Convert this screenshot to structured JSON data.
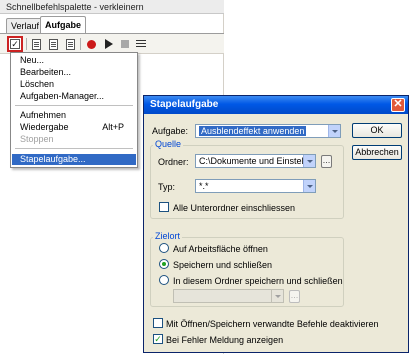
{
  "palette": {
    "title": "Schnellbefehlspalette - verkleinern",
    "tabs": [
      {
        "label": "Verlauf",
        "active": false
      },
      {
        "label": "Aufgabe",
        "active": true
      }
    ],
    "toolbar_icons": [
      "checkbox-icon",
      "new-document-icon",
      "new-document-icon",
      "new-document-icon",
      "record-icon",
      "play-icon",
      "stop-icon",
      "list-icon"
    ]
  },
  "menu": {
    "items": [
      {
        "label": "Neu...",
        "state": "normal"
      },
      {
        "label": "Bearbeiten...",
        "state": "normal"
      },
      {
        "label": "Löschen",
        "state": "normal"
      },
      {
        "label": "Aufgaben-Manager...",
        "state": "normal"
      },
      {
        "label": "Aufnehmen",
        "state": "normal"
      },
      {
        "label": "Wiedergabe",
        "shortcut": "Alt+P",
        "state": "normal"
      },
      {
        "label": "Stoppen",
        "state": "disabled"
      },
      {
        "label": "Stapelaufgabe...",
        "state": "selected"
      }
    ]
  },
  "dialog": {
    "title": "Stapelaufgabe",
    "aufgabe_label": "Aufgabe:",
    "aufgabe_value": "Ausblendeffekt anwenden",
    "ok_label": "OK",
    "cancel_label": "Abbrechen",
    "quelle": {
      "legend": "Quelle",
      "ordner_label": "Ordner:",
      "ordner_value": "C:\\Dokumente und Einstellun",
      "typ_label": "Typ:",
      "typ_value": "*.*",
      "subfolders_label": "Alle Unterordner einschliessen",
      "subfolders_checked": false
    },
    "zielort": {
      "legend": "Zielort",
      "options": [
        {
          "label": "Auf Arbeitsfläche öffnen",
          "checked": false
        },
        {
          "label": "Speichern und schließen",
          "checked": true
        },
        {
          "label": "In diesem Ordner speichern und schließen",
          "checked": false
        }
      ],
      "target_folder_value": ""
    },
    "option_deactivate_label": "Mit Öffnen/Speichern verwandte Befehle deaktivieren",
    "option_deactivate_checked": false,
    "option_errors_label": "Bei Fehler Meldung anzeigen",
    "option_errors_checked": true
  },
  "colors": {
    "accent_red": "#cc2222",
    "selection": "#316ac5",
    "titlebar": "#0058e6",
    "group_legend": "#0046d5"
  }
}
